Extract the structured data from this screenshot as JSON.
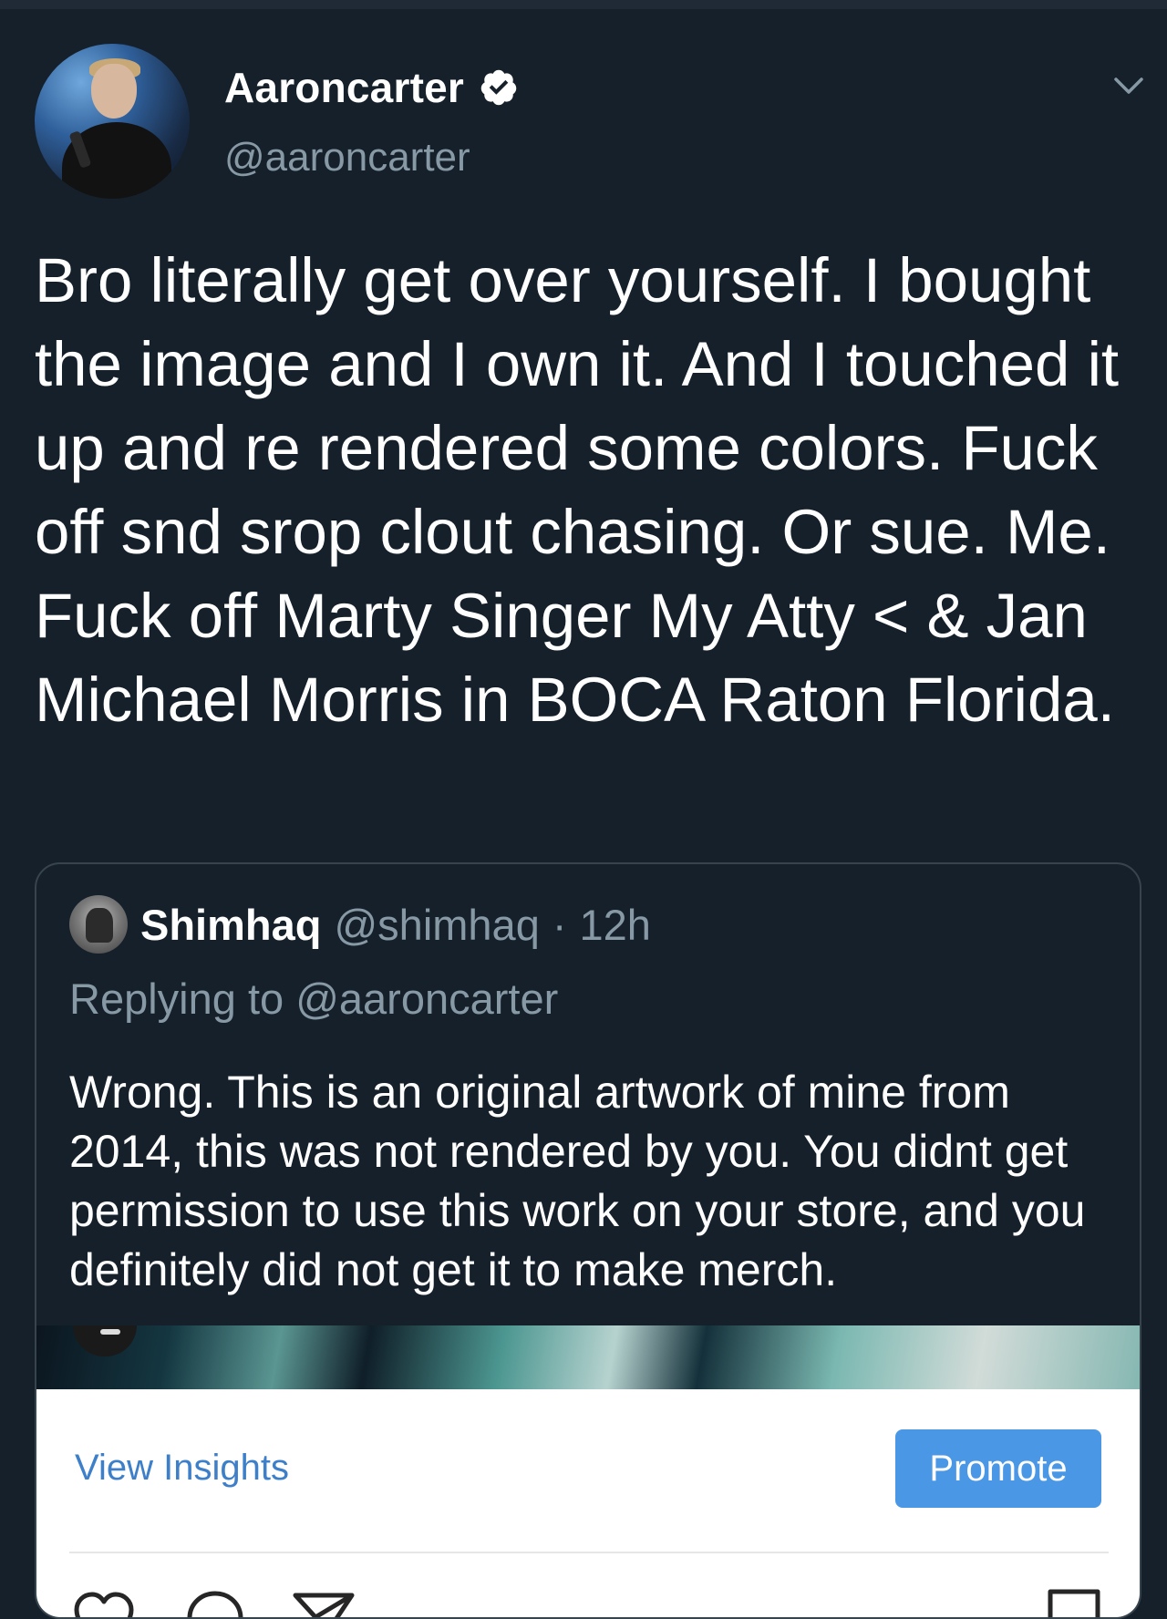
{
  "tweet": {
    "display_name": "Aaroncarter",
    "handle": "@aaroncarter",
    "text": "Bro literally get over yourself. I bought the image and I own it. And I touched it up and re rendered some colors. Fuck off snd srop clout chasing. Or sue. Me. Fuck off Marty Singer My Atty < & Jan Michael Morris in BOCA Raton Florida."
  },
  "quoted_tweet": {
    "display_name": "Shimhaq",
    "handle": "@shimhaq",
    "separator": "·",
    "time": "12h",
    "replying_to": "Replying to @aaroncarter",
    "text": "Wrong. This is an original artwork of mine from 2014, this was not rendered by you. You didnt get permission to use this work on your store, and you definitely did not get it to make merch.",
    "embedded_screenshot": {
      "view_insights_label": "View Insights",
      "promote_label": "Promote",
      "icons": [
        "heart-icon",
        "comment-icon",
        "send-icon",
        "bookmark-icon"
      ]
    }
  },
  "colors": {
    "background": "#15202b",
    "secondary_text": "#8899a6",
    "border": "#38444d",
    "verified": "#ffffff",
    "promote_button": "#4a97e6",
    "insights_link": "#3d80c9"
  }
}
